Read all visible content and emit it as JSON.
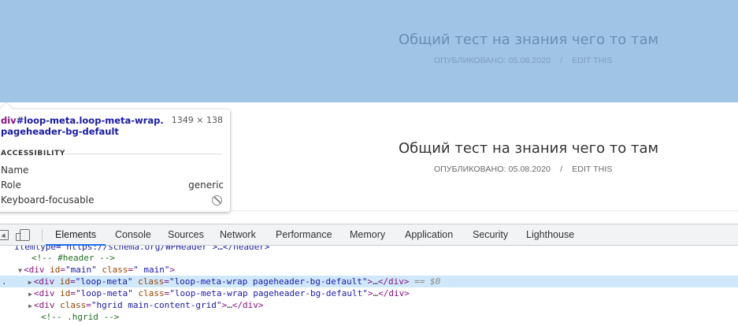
{
  "page": {
    "hero": {
      "title": "Общий тест на знания чего то там",
      "published_label": "ОПУБЛИКОВАНО:",
      "date": "05.08.2020",
      "separator": "/",
      "edit_link": "EDIT THIS"
    },
    "main": {
      "title": "Общий тест на знания чего то там",
      "published_label": "ОПУБЛИКОВАНО:",
      "date": "05.08.2020",
      "separator": "/",
      "edit_link": "EDIT THIS"
    }
  },
  "inspect_tooltip": {
    "selector_tag": "div",
    "selector_rest": "#loop-meta.loop-meta-wrap.pageheader-bg-default",
    "dimensions": "1349 × 138",
    "section_title": "ACCESSIBILITY",
    "rows": [
      {
        "label": "Name",
        "value": ""
      },
      {
        "label": "Role",
        "value": "generic"
      },
      {
        "label": "Keyboard-focusable",
        "value": "",
        "icon": "not-allowed-icon"
      }
    ]
  },
  "devtools": {
    "tabs": [
      "Elements",
      "Console",
      "Sources",
      "Network",
      "Performance",
      "Memory",
      "Application",
      "Security",
      "Lighthouse"
    ],
    "active_tab": "Elements",
    "code": {
      "line0": "itemtype=\"https://schema.org/WPHeader\">…</header>",
      "line1_comment": "<!-- #header -->",
      "line2_tag_open": "<div ",
      "line2_attr1": "id",
      "line2_val1": "\"main\"",
      "line2_attr2": "class",
      "line2_val2": "\" main\"",
      "line3_attr1": "id",
      "line3_val1": "\"loop-meta\"",
      "line3_attr2": "class",
      "line3_val2": "\"loop-meta-wrap pageheader-bg-default\"",
      "line3_marker": "== $0",
      "line4_attr1": "id",
      "line4_val1": "\"loop-meta\"",
      "line4_attr2": "class",
      "line4_val2": "\"loop-meta-wrap pageheader-bg-default\"",
      "line5_attr1": "class",
      "line5_val1": "\"hgrid main-content-grid\"",
      "line6_comment": "<!-- .hgrid -->"
    }
  },
  "colors": {
    "highlight": "#a0c4e6",
    "selected_row": "#cfe8fc",
    "active_tab_underline": "#1a73e8"
  }
}
